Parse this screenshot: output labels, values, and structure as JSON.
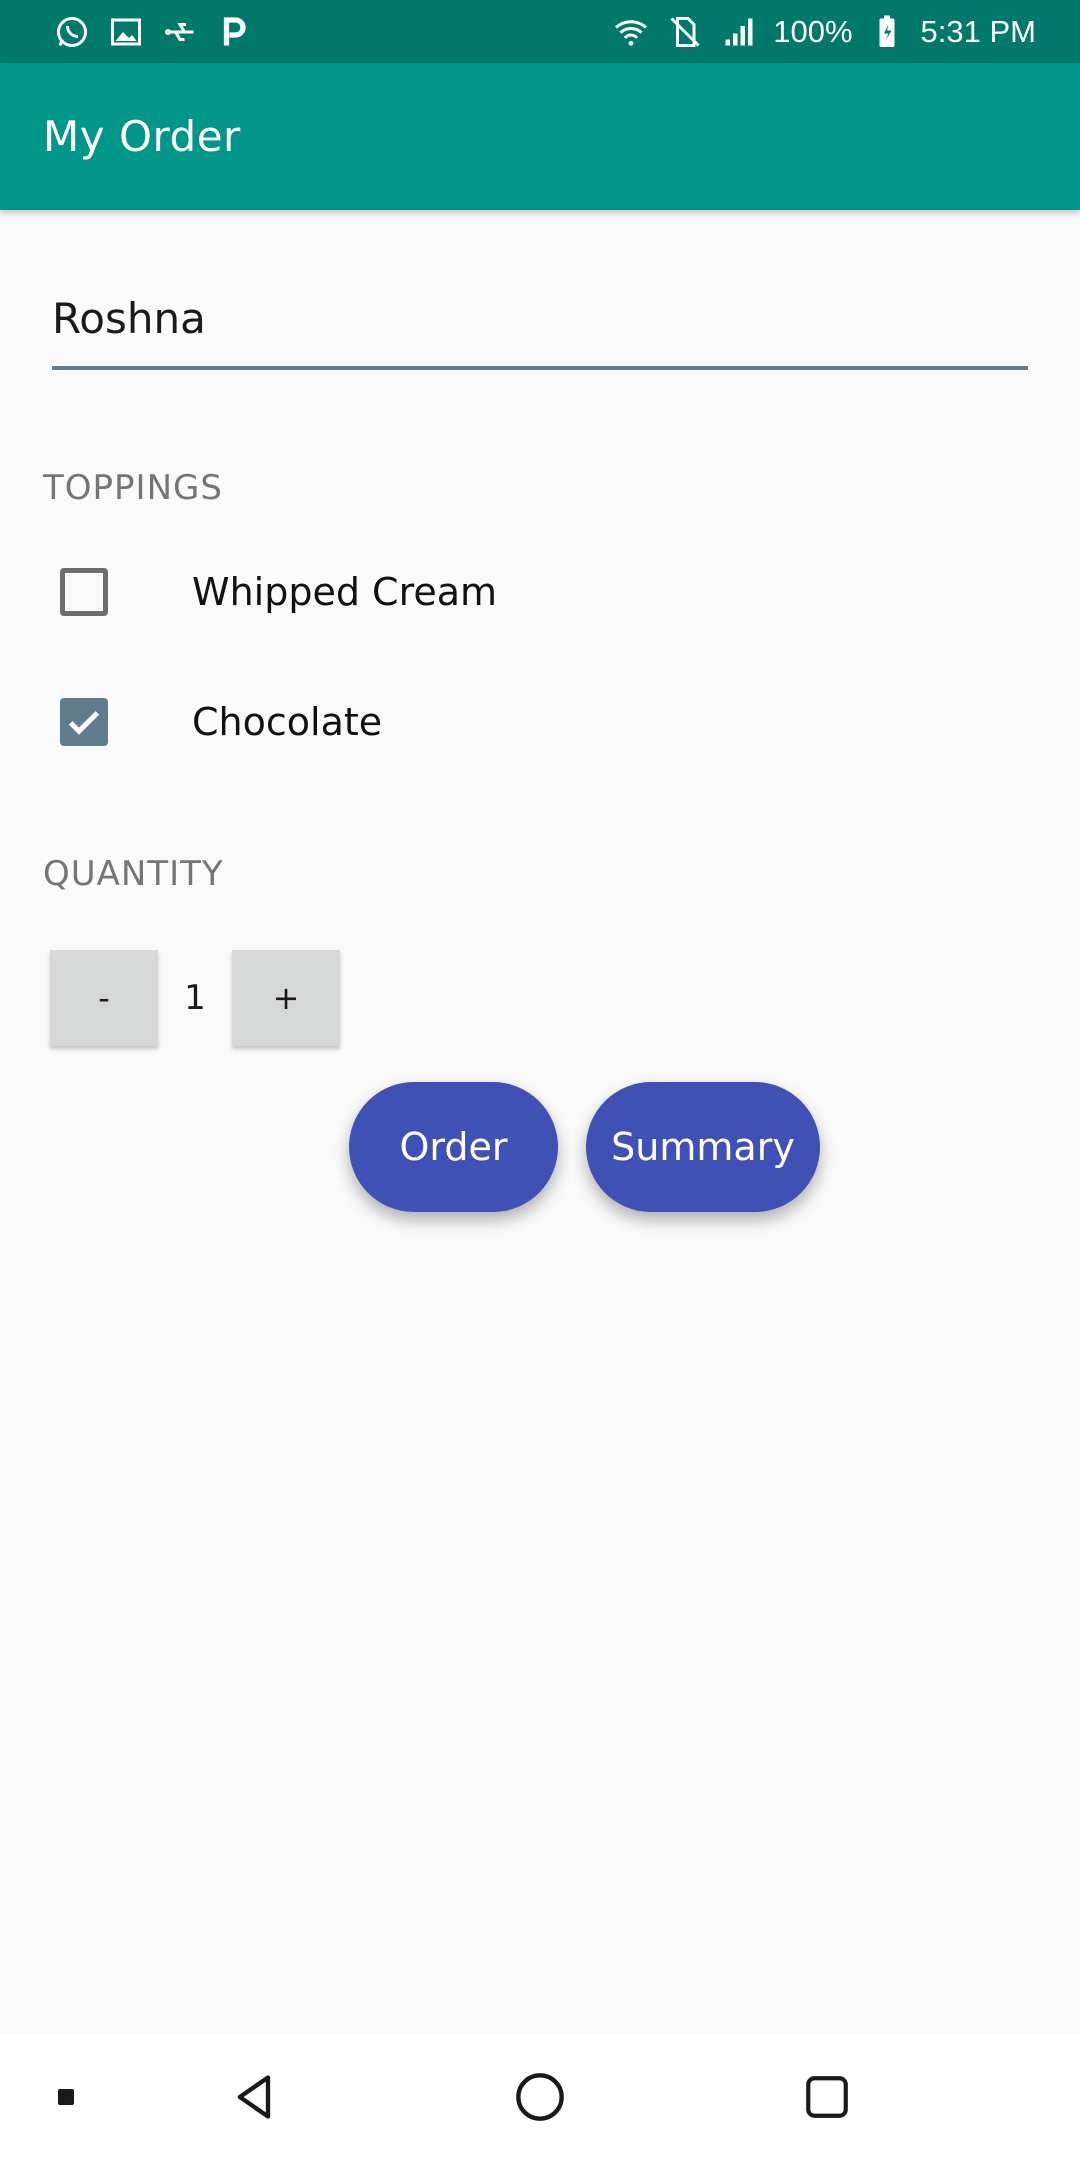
{
  "status_bar": {
    "left_icons": [
      "whatsapp-icon",
      "image-icon",
      "usb-icon",
      "parking-icon"
    ],
    "right_icons": [
      "wifi-icon",
      "no-sim-icon",
      "signal-icon"
    ],
    "battery": "100%",
    "battery_icon": "battery-charging-icon",
    "time": "5:31 PM"
  },
  "app_bar": {
    "title": "My Order"
  },
  "name_input": {
    "value": "Roshna"
  },
  "toppings": {
    "label": "TOPPINGS",
    "items": [
      {
        "label": "Whipped Cream",
        "checked": false
      },
      {
        "label": "Chocolate",
        "checked": true
      }
    ]
  },
  "quantity": {
    "label": "QUANTITY",
    "decrement": "-",
    "value": "1",
    "increment": "+"
  },
  "actions": {
    "order": "Order",
    "summary": "Summary"
  },
  "nav_bar": {
    "icons": [
      "recent-dot-icon",
      "back-icon",
      "home-icon",
      "overview-icon"
    ]
  },
  "colors": {
    "status_bar": "#00796b",
    "app_bar": "#009688",
    "accent": "#3f51b5",
    "checkbox": "#607d8b",
    "background": "#fafafa"
  }
}
